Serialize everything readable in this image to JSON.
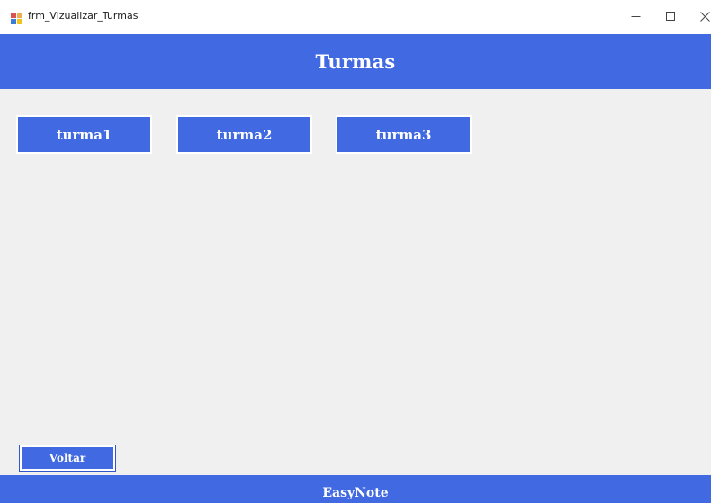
{
  "window": {
    "title": "frm_Vizualizar_Turmas",
    "icon": "winforms-app-icon",
    "controls": {
      "minimize_icon": "minimize-icon",
      "maximize_icon": "maximize-icon",
      "close_icon": "close-icon"
    }
  },
  "header": {
    "title": "Turmas"
  },
  "turmas": [
    {
      "label": "turma1"
    },
    {
      "label": "turma2"
    },
    {
      "label": "turma3"
    }
  ],
  "actions": {
    "back_label": "Voltar"
  },
  "footer": {
    "brand": "EasyNote"
  },
  "colors": {
    "accent": "#4169e1",
    "background": "#f0f0f0",
    "text_on_accent": "#ffffff"
  }
}
